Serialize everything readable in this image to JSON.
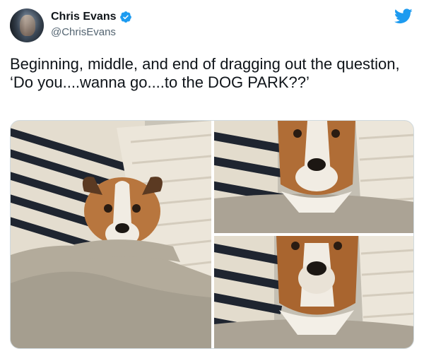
{
  "tweet": {
    "author": {
      "display_name": "Chris Evans",
      "handle": "@ChrisEvans",
      "verified": true,
      "avatar_icon": "profile-photo"
    },
    "platform_icon": "twitter-bird-icon",
    "text": "Beginning, middle, and end of dragging out the question, ‘Do you....wanna go....to the DOG PARK??’",
    "media": [
      {
        "name": "photo-beginning",
        "subject": "dog-peeking-under-blanket"
      },
      {
        "name": "photo-middle",
        "subject": "dog-head-raised"
      },
      {
        "name": "photo-end",
        "subject": "dog-head-fully-raised"
      }
    ]
  },
  "colors": {
    "verified_blue": "#1d9bf0",
    "twitter_blue": "#1d9bf0",
    "text_primary": "#0f1419",
    "text_secondary": "#536471",
    "border": "#cfd9de"
  }
}
